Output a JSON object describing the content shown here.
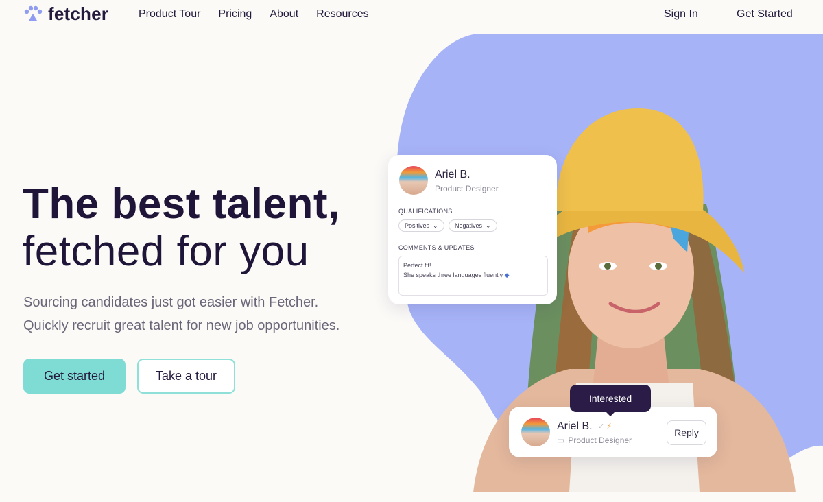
{
  "nav": {
    "brand": "fetcher",
    "links": [
      "Product Tour",
      "Pricing",
      "About",
      "Resources"
    ],
    "sign_in": "Sign In",
    "get_started": "Get Started"
  },
  "hero": {
    "title_line1": "The best talent,",
    "title_line2": "fetched for you",
    "subtitle_line1": "Sourcing candidates just got easier with Fetcher.",
    "subtitle_line2": "Quickly recruit great talent for new job opportunities.",
    "primary_cta": "Get started",
    "secondary_cta": "Take a tour"
  },
  "profile_card": {
    "name": "Ariel B.",
    "role": "Product Designer",
    "qualifications_label": "QUALIFICATIONS",
    "positives": "Positives",
    "negatives": "Negatives",
    "comments_label": "COMMENTS & UPDATES",
    "comment_line1": "Perfect fit!",
    "comment_line2": "She speaks three languages fluently"
  },
  "reply_card": {
    "tooltip": "Interested",
    "name": "Ariel B.",
    "role": "Product Designer",
    "reply": "Reply"
  },
  "colors": {
    "blob": "#a7b3f7",
    "accent_teal": "#7fdcd4",
    "text_dark": "#1e1538",
    "tooltip_bg": "#2a1c46"
  }
}
